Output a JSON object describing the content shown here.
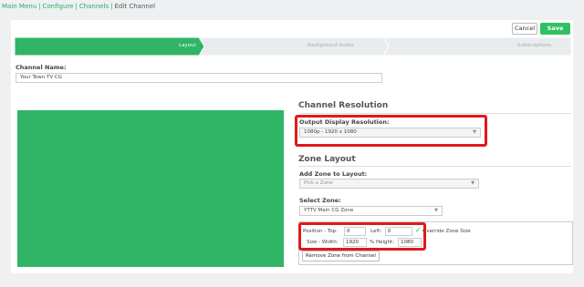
{
  "breadcrumb": {
    "items": [
      "Main Menu",
      "Configure",
      "Channels"
    ],
    "separator": "|",
    "current": "Edit Channel"
  },
  "header": {
    "cancel_label": "Cancel",
    "save_label": "Save"
  },
  "wizard": {
    "steps": [
      {
        "label": "Layout",
        "active": true
      },
      {
        "label": "Background Audio",
        "active": false
      },
      {
        "label": "Subscriptions",
        "active": false
      }
    ],
    "active_color": "#2fb565",
    "inactive_color": "#e9ecee"
  },
  "channel_name": {
    "label": "Channel Name:",
    "value": "Your Town TV CG"
  },
  "resolution": {
    "title": "Channel Resolution",
    "label": "Output Display Resolution:",
    "selected": "1080p - 1920 x 1080"
  },
  "zone_layout": {
    "title": "Zone Layout",
    "add_label": "Add Zone to Layout:",
    "add_placeholder": "Pick a Zone",
    "select_label": "Select Zone:",
    "select_selected": "YTTV Main CG Zone",
    "position_top_label": "Position - Top:",
    "position_top_value": "0",
    "left_label": "Left:",
    "left_value": "0",
    "override_label": "Override Zone Size",
    "override_checked": true,
    "size_width_label": "Size - Width:",
    "size_width_value": "1920",
    "height_label": "% Height:",
    "height_value": "1080",
    "remove_label": "Remove Zone from Channel"
  },
  "colors": {
    "accent": "#2fc15f",
    "preview": "#2fb565",
    "highlight": "#e11919"
  }
}
